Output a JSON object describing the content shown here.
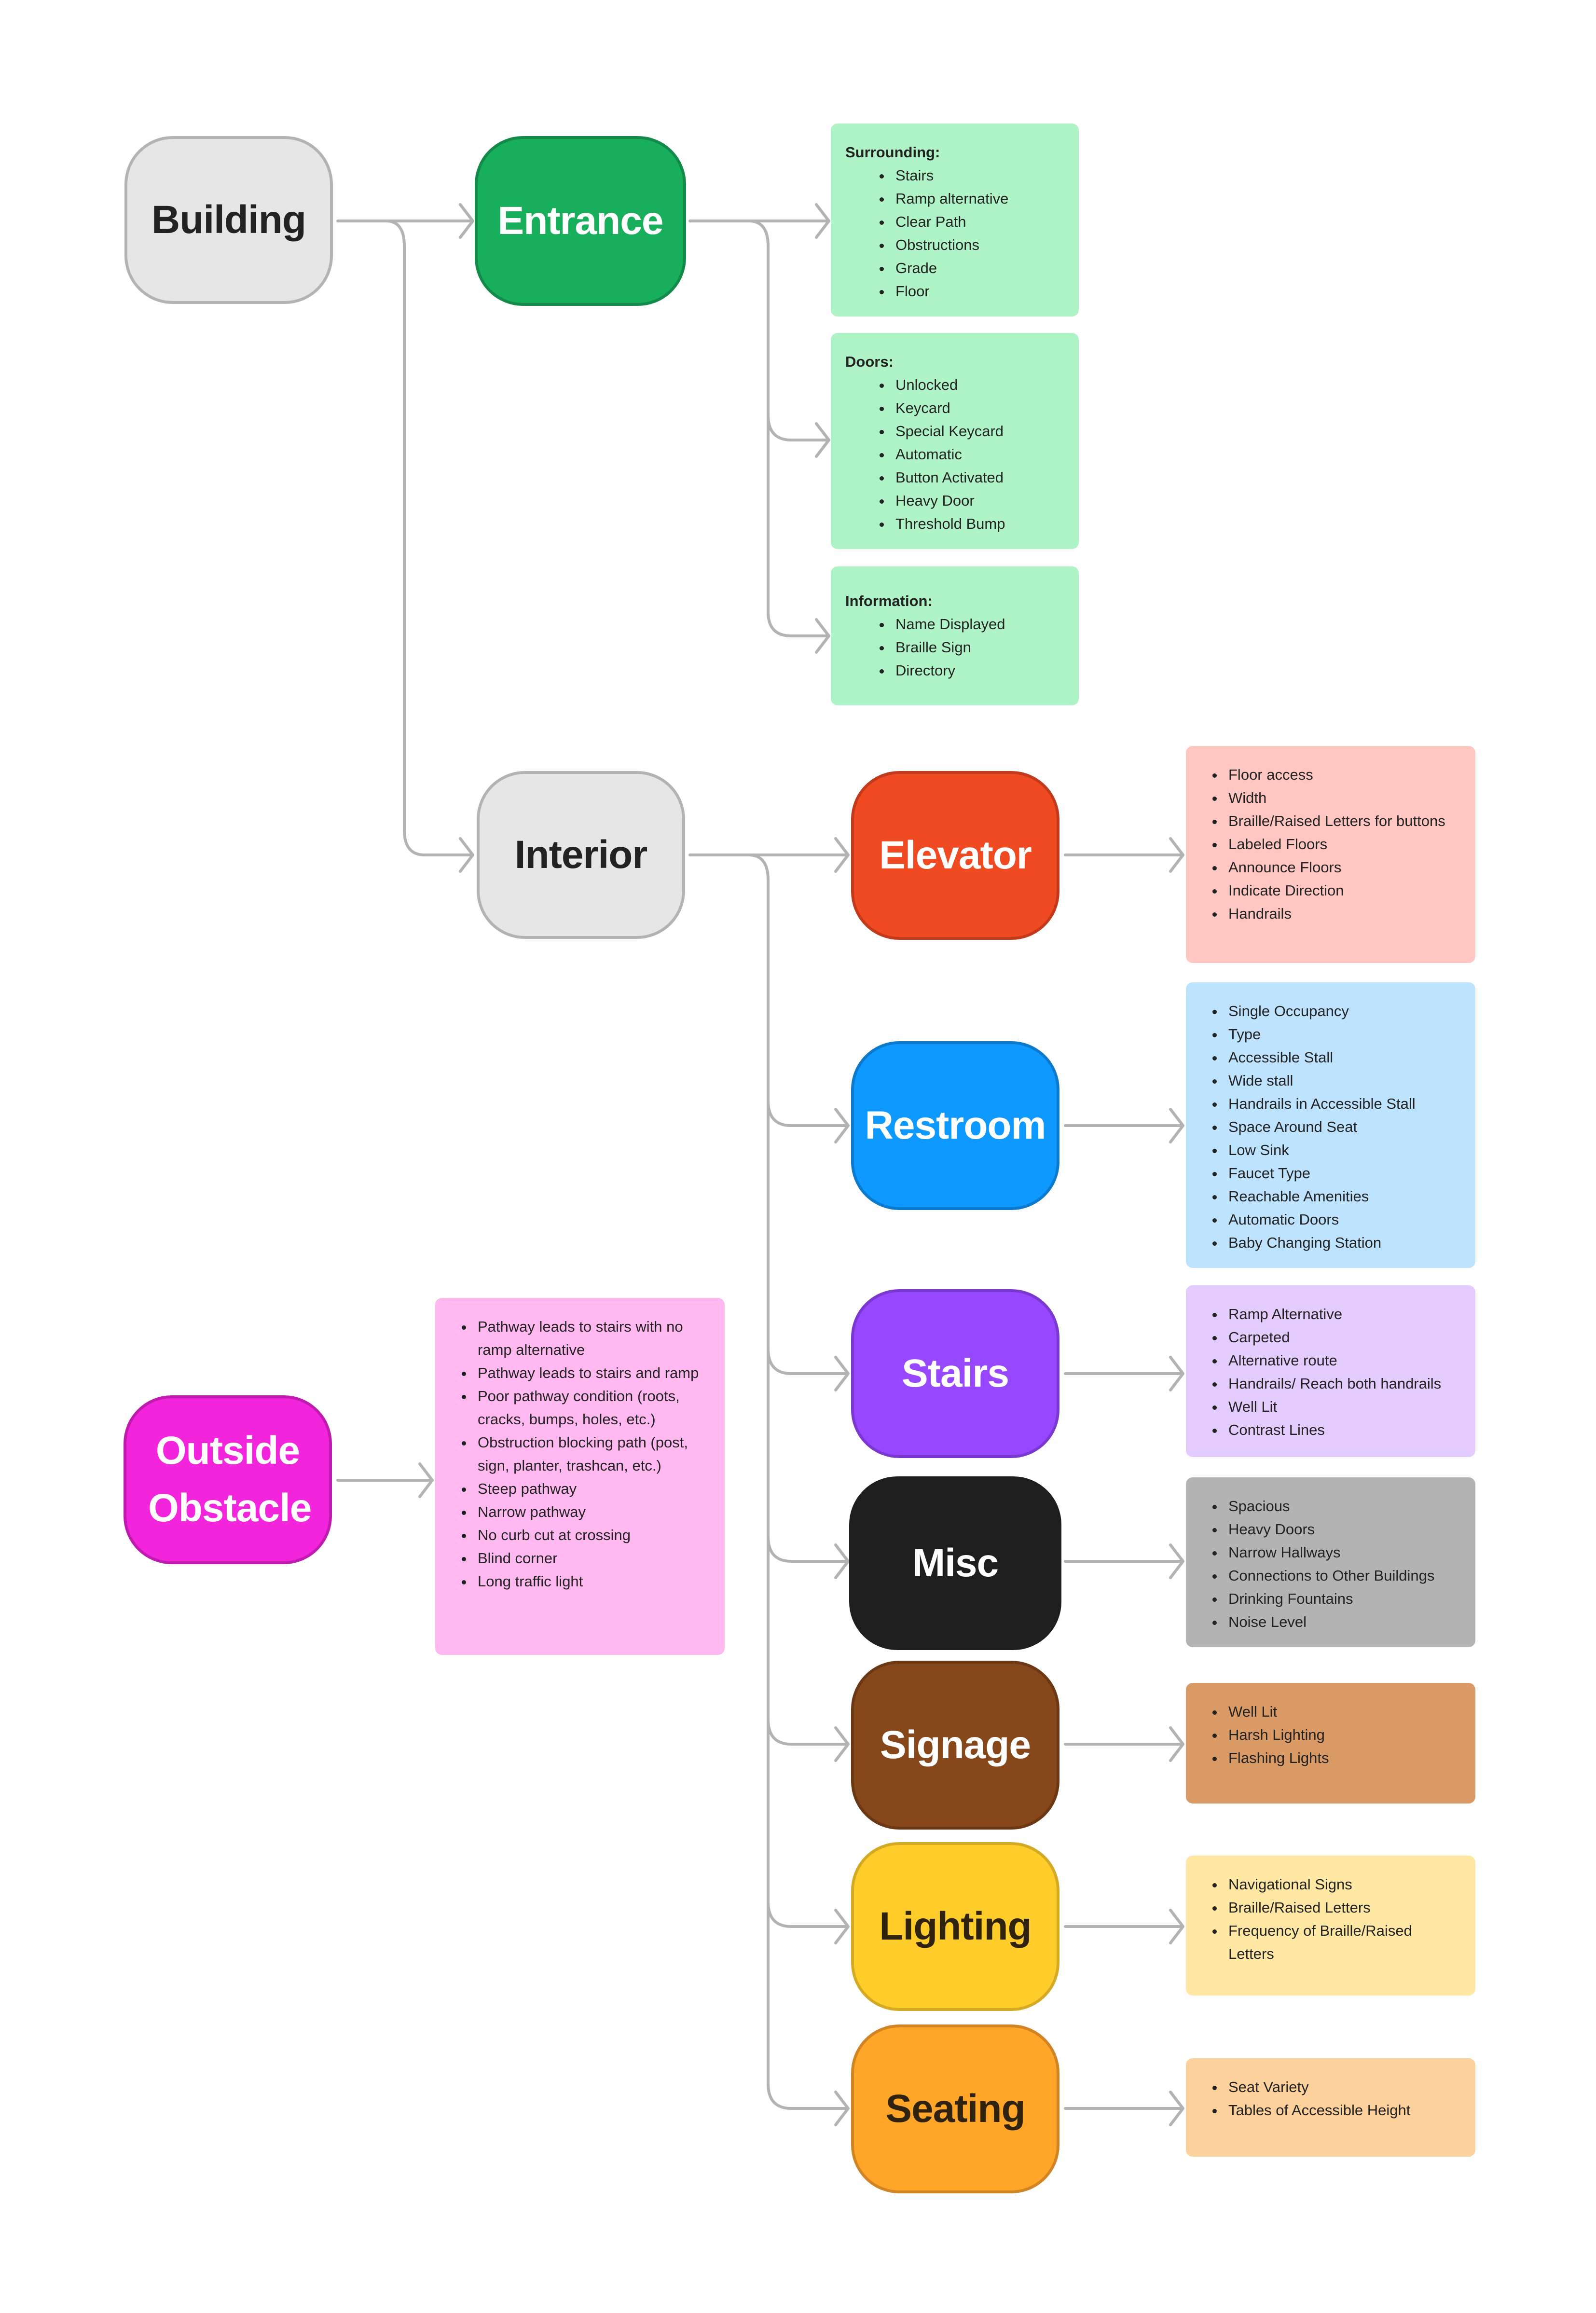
{
  "diagram": {
    "nodes": {
      "building": {
        "label": "Building",
        "fill": "#E6E6E6",
        "border": "#B3B3B3",
        "text": "#222222"
      },
      "entrance": {
        "label": "Entrance",
        "fill": "#17AE5C",
        "border": "#138A49",
        "text": "#FFFFFF"
      },
      "interior": {
        "label": "Interior",
        "fill": "#E6E6E6",
        "border": "#B3B3B3",
        "text": "#222222"
      },
      "outside_obstacle": {
        "label": "Outside Obstacle",
        "fill": "#F224DC",
        "border": "#C01BAF",
        "text": "#FFFFFF"
      },
      "elevator": {
        "label": "Elevator",
        "fill": "#F04A23",
        "border": "#C13A1C",
        "text": "#FFFFFF"
      },
      "restroom": {
        "label": "Restroom",
        "fill": "#0D99FF",
        "border": "#0B7ACC",
        "text": "#FFFFFF"
      },
      "stairs": {
        "label": "Stairs",
        "fill": "#9747FF",
        "border": "#7A38D0",
        "text": "#FFFFFF"
      },
      "misc": {
        "label": "Misc",
        "fill": "#1E1E1E",
        "border": "#1E1E1E",
        "text": "#FFFFFF"
      },
      "signage": {
        "label": "Signage",
        "fill": "#86471A",
        "border": "#6A3814",
        "text": "#FFFFFF"
      },
      "lighting": {
        "label": "Lighting",
        "fill": "#FFCD29",
        "border": "#D4A923",
        "text": "#2F230D"
      },
      "seating": {
        "label": "Seating",
        "fill": "#FFA629",
        "border": "#D08424",
        "text": "#2F230D"
      }
    },
    "cards": {
      "entrance_surrounding": {
        "heading": "Surrounding:",
        "color": "#AFF4C6",
        "items": [
          "Stairs",
          "Ramp alternative",
          "Clear Path",
          "Obstructions",
          "Grade",
          "Floor"
        ]
      },
      "entrance_doors": {
        "heading": "Doors:",
        "color": "#AFF4C6",
        "items": [
          "Unlocked",
          "Keycard",
          "Special Keycard",
          "Automatic",
          "Button Activated",
          "Heavy Door",
          "Threshold Bump"
        ]
      },
      "entrance_information": {
        "heading": "Information:",
        "color": "#AFF4C6",
        "items": [
          "Name Displayed",
          "Braille Sign",
          "Directory"
        ]
      },
      "elevator": {
        "color": "#FFC7C2",
        "items": [
          "Floor access",
          "Width",
          "Braille/Raised Letters for buttons",
          "Labeled Floors",
          "Announce Floors",
          "Indicate Direction",
          "Handrails"
        ]
      },
      "restroom": {
        "color": "#BDE3FF",
        "items": [
          "Single Occupancy",
          "Type",
          "Accessible Stall",
          "Wide stall",
          "Handrails in Accessible Stall",
          "Space Around Seat",
          "Low Sink",
          "Faucet Type",
          "Reachable Amenities",
          "Automatic Doors",
          "Baby Changing Station"
        ]
      },
      "stairs": {
        "color": "#E4CCFF",
        "items": [
          "Ramp Alternative",
          "Carpeted",
          "Alternative route",
          "Handrails/ Reach both handrails",
          "Well Lit",
          "Contrast Lines"
        ]
      },
      "misc": {
        "color": "#B3B3B3",
        "items": [
          "Spacious",
          "Heavy Doors",
          "Narrow Hallways",
          "Connections to Other Buildings",
          "Drinking Fountains",
          "Noise Level"
        ]
      },
      "signage": {
        "color": "#DA9A65",
        "items": [
          "Well Lit",
          "Harsh Lighting",
          "Flashing Lights"
        ]
      },
      "lighting": {
        "color": "#FFE8A3",
        "items": [
          "Navigational Signs",
          "Braille/Raised Letters",
          "Frequency of Braille/Raised Letters"
        ]
      },
      "seating": {
        "color": "#FCD19C",
        "items": [
          "Seat Variety",
          "Tables of Accessible Height"
        ]
      },
      "outside_obstacle": {
        "color": "#FFB8F0",
        "items": [
          "Pathway leads to stairs with no ramp alternative",
          "Pathway leads to stairs and ramp",
          "Poor pathway condition (roots, cracks, bumps, holes, etc.)",
          "Obstruction blocking path (post, sign, planter, trashcan, etc.)",
          "Steep pathway",
          "Narrow pathway",
          "No curb cut at crossing",
          "Blind corner",
          "Long traffic light"
        ]
      }
    },
    "connector_color": "#B3B3B3",
    "edges": [
      [
        "building",
        "entrance"
      ],
      [
        "building",
        "interior"
      ],
      [
        "entrance",
        "entrance_surrounding"
      ],
      [
        "entrance",
        "entrance_doors"
      ],
      [
        "entrance",
        "entrance_information"
      ],
      [
        "interior",
        "elevator"
      ],
      [
        "interior",
        "restroom"
      ],
      [
        "interior",
        "stairs"
      ],
      [
        "interior",
        "misc"
      ],
      [
        "interior",
        "signage"
      ],
      [
        "interior",
        "lighting"
      ],
      [
        "interior",
        "seating"
      ],
      [
        "elevator",
        "elevator_card"
      ],
      [
        "restroom",
        "restroom_card"
      ],
      [
        "stairs",
        "stairs_card"
      ],
      [
        "misc",
        "misc_card"
      ],
      [
        "signage",
        "signage_card"
      ],
      [
        "lighting",
        "lighting_card"
      ],
      [
        "seating",
        "seating_card"
      ],
      [
        "outside_obstacle",
        "outside_obstacle_card"
      ]
    ]
  }
}
